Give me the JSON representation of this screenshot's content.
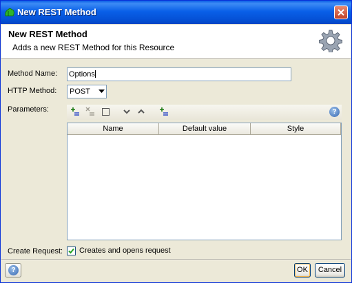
{
  "window": {
    "title": "New REST Method"
  },
  "header": {
    "title": "New REST Method",
    "subtitle": "Adds a new REST Method for this Resource"
  },
  "form": {
    "method_name_label": "Method Name:",
    "method_name_value": "Options",
    "http_method_label": "HTTP Method:",
    "http_method_value": "POST",
    "parameters_label": "Parameters:",
    "create_request_label": "Create Request:",
    "create_request_checkbox_label": "Creates and opens request",
    "create_request_checked": true
  },
  "parameters_table": {
    "columns": [
      "Name",
      "Default value",
      "Style"
    ],
    "rows": []
  },
  "toolbar_icons": [
    "add-param-icon",
    "remove-param-icon",
    "clear-icon",
    "move-down-icon",
    "move-up-icon",
    "add-param-alt-icon",
    "help-icon"
  ],
  "footer": {
    "help_glyph": "?",
    "ok_label": "OK",
    "cancel_label": "Cancel"
  },
  "colors": {
    "titlebar": "#0a5fe6",
    "close": "#c0442b",
    "dialog_bg": "#ece9d8"
  }
}
